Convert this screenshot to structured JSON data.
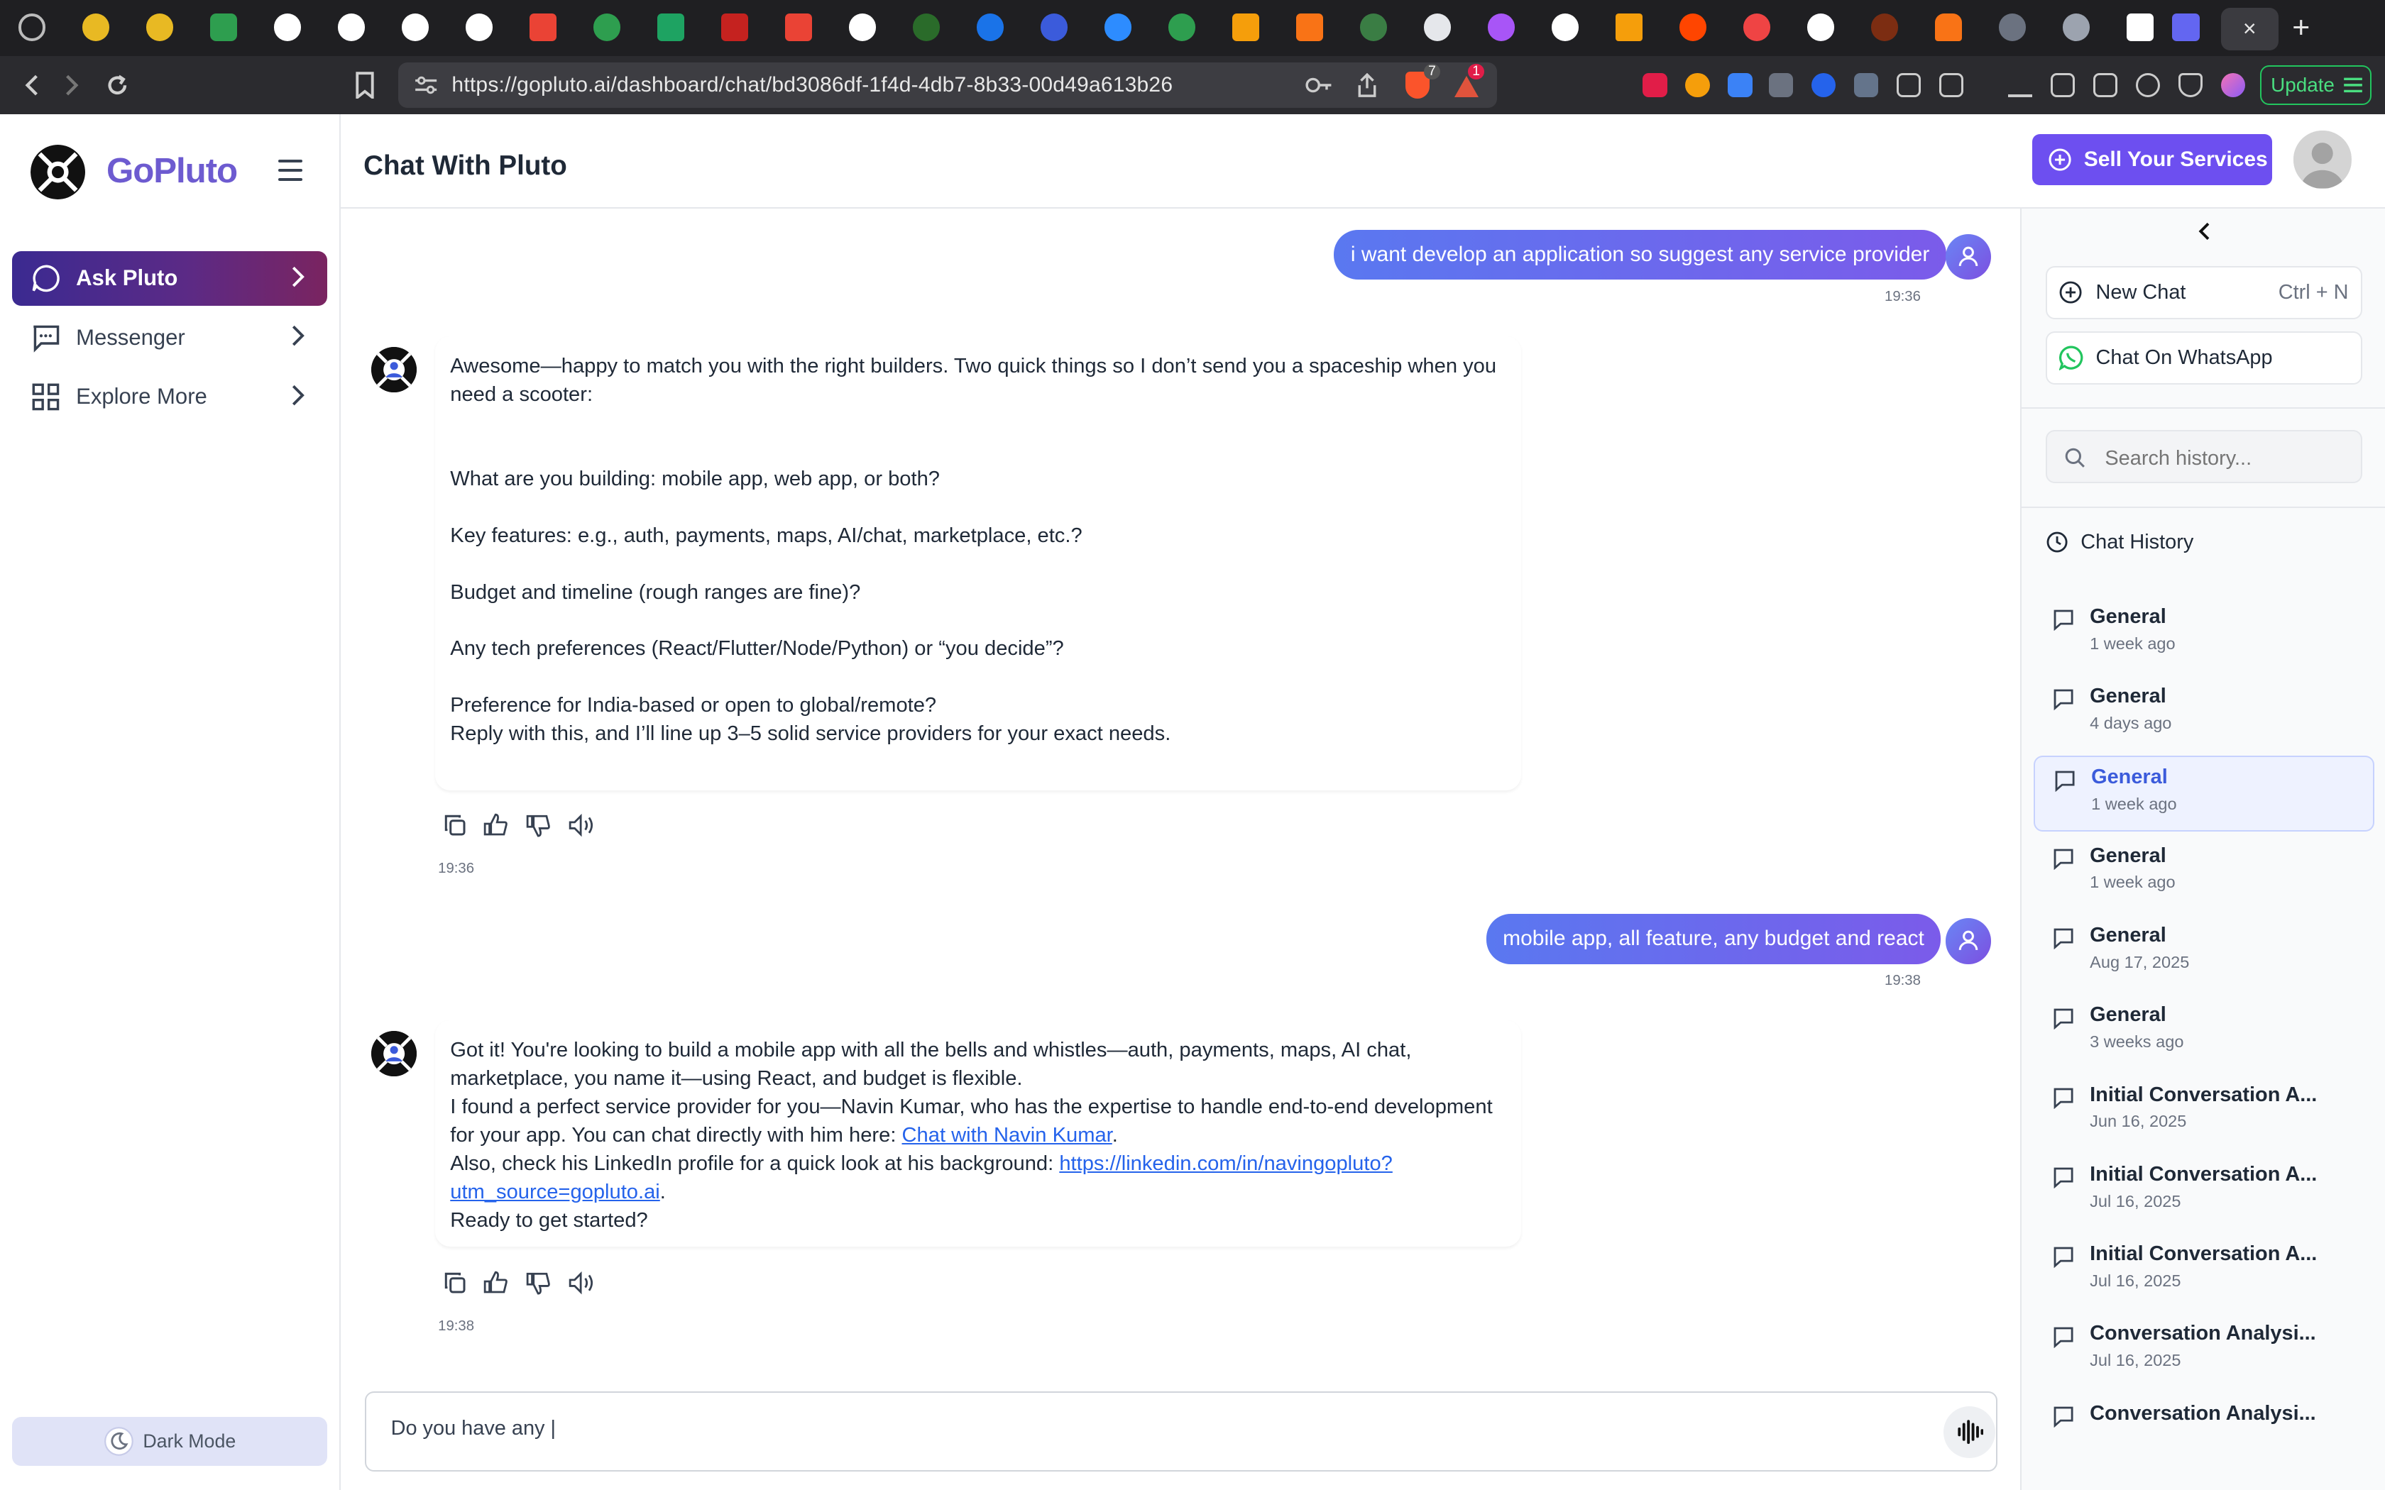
{
  "browser": {
    "url": "https://gopluto.ai/dashboard/chat/bd3086df-1f4d-4db7-8b33-00d49a613b26",
    "update_label": "Update",
    "tab_close": "×",
    "new_tab": "+",
    "badge_brave": "7",
    "badge_alert": "1"
  },
  "sidebar": {
    "brand": "GoPluto",
    "items": [
      {
        "label": "Ask Pluto"
      },
      {
        "label": "Messenger"
      },
      {
        "label": "Explore More"
      }
    ],
    "dark_mode": "Dark Mode"
  },
  "header": {
    "title": "Chat With Pluto",
    "sell_button": "Sell Your Services"
  },
  "chat": {
    "messages": [
      {
        "role": "user",
        "text": "i want develop an application so suggest any service provider",
        "time": "19:36"
      },
      {
        "role": "bot",
        "time": "19:36",
        "lines": [
          "Awesome—happy to match you with the right builders. Two quick things so I don’t send you a spaceship when you",
          "need a scooter:",
          "What are you building: mobile app, web app, or both?",
          "Key features: e.g., auth, payments, maps, AI/chat, marketplace, etc.?",
          "Budget and timeline (rough ranges are fine)?",
          "Any tech preferences (React/Flutter/Node/Python) or “you decide”?",
          "Preference for India-based or open to global/remote?",
          "Reply with this, and I’ll line up 3–5 solid service providers for your exact needs."
        ]
      },
      {
        "role": "user",
        "text": "mobile app, all feature, any budget and react",
        "time": "19:38"
      },
      {
        "role": "bot",
        "time": "19:38",
        "lines": [
          "Got it! You're looking to build a mobile app with all the bells and whistles—auth, payments, maps, AI chat,",
          "marketplace, you name it—using React, and budget is flexible.",
          "I found a perfect service provider for you—Navin Kumar, who has the expertise to handle end-to-end development",
          "for your app. You can chat directly with him here: ",
          "Chat with Navin Kumar",
          ".",
          "Also, check his LinkedIn profile for a quick look at his background: ",
          "https://linkedin.com/in/navingopluto?",
          "utm_source=gopluto.ai",
          ".",
          "Ready to get started?"
        ]
      }
    ],
    "input_value": "Do you have any |"
  },
  "history": {
    "new_chat": "New Chat",
    "shortcut": "Ctrl + N",
    "whatsapp": "Chat On WhatsApp",
    "search_placeholder": "Search history...",
    "title": "Chat History",
    "items": [
      {
        "name": "General",
        "date": "1 week ago"
      },
      {
        "name": "General",
        "date": "4 days ago"
      },
      {
        "name": "General",
        "date": "1 week ago",
        "selected": true
      },
      {
        "name": "General",
        "date": "1 week ago"
      },
      {
        "name": "General",
        "date": "Aug 17, 2025"
      },
      {
        "name": "General",
        "date": "3 weeks ago"
      },
      {
        "name": "Initial Conversation A...",
        "date": "Jun 16, 2025"
      },
      {
        "name": "Initial Conversation A...",
        "date": "Jul 16, 2025"
      },
      {
        "name": "Initial Conversation A...",
        "date": "Jul 16, 2025"
      },
      {
        "name": "Conversation Analysi...",
        "date": "Jul 16, 2025"
      },
      {
        "name": "Conversation Analysi...",
        "date": ""
      }
    ]
  },
  "colors": {
    "brand": "#6d5bd0",
    "accent": "#6d4ff0",
    "user_bubble": "#6a6ef0",
    "link": "#2563eb"
  }
}
